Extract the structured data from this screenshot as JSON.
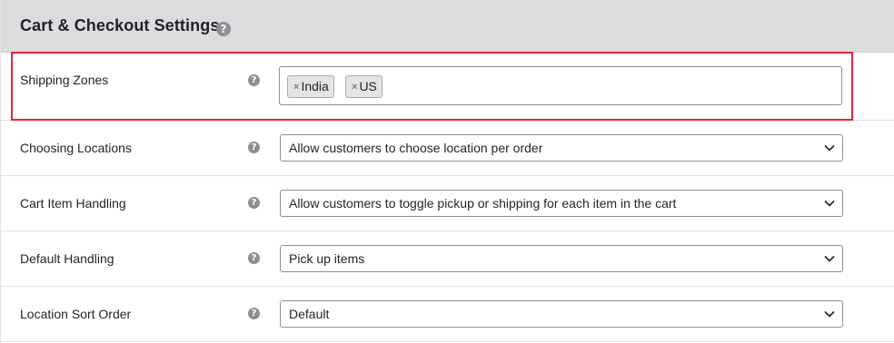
{
  "header": {
    "title": "Cart & Checkout Settings",
    "help_icon": "question-circle-icon"
  },
  "shipping_zones": {
    "label": "Shipping Zones",
    "chips": [
      {
        "remove": "×",
        "label": "India"
      },
      {
        "remove": "×",
        "label": "US"
      }
    ]
  },
  "rows": [
    {
      "label": "Choosing Locations",
      "value": "Allow customers to choose location per order"
    },
    {
      "label": "Cart Item Handling",
      "value": "Allow customers to toggle pickup or shipping for each item in the cart"
    },
    {
      "label": "Default Handling",
      "value": "Pick up items"
    },
    {
      "label": "Location Sort Order",
      "value": "Default"
    }
  ],
  "help_glyph": "?",
  "colors": {
    "header_bg": "#dcdcde",
    "highlight": "#e2213e",
    "help_icon": "#8c8f94"
  }
}
